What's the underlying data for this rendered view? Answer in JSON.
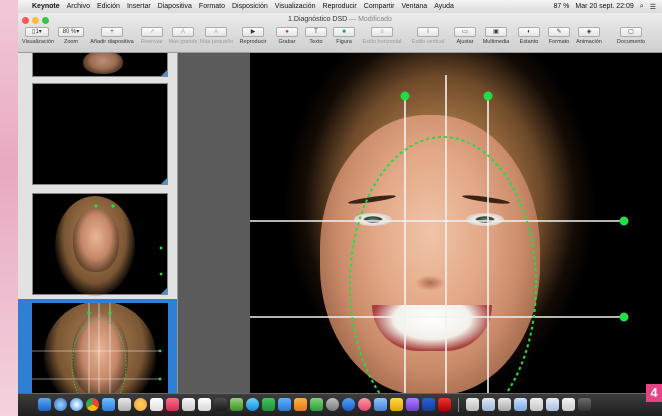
{
  "menubar": {
    "app_name": "Keynote",
    "items": [
      "Archivo",
      "Edición",
      "Insertar",
      "Diapositiva",
      "Formato",
      "Disposición",
      "Visualización",
      "Reproducir",
      "Compartir",
      "Ventana",
      "Ayuda"
    ],
    "battery": "87 %",
    "datetime": "Mar 20 sept. 22:09"
  },
  "window": {
    "title": "1.Diagnóstico DSD",
    "title_suffix": "— Modificado"
  },
  "toolbar": {
    "items": [
      {
        "label": "Visualización",
        "btn": "▯1▾"
      },
      {
        "label": "Zoom",
        "btn": "80 %▾"
      },
      {
        "label": "Añadir diapositiva",
        "btn": "+"
      },
      {
        "label": "Reenviar",
        "btn": "↗"
      },
      {
        "label": "Más grande",
        "btn": "A"
      },
      {
        "label": "Más pequeño",
        "btn": "A"
      },
      {
        "label": "Reproducir",
        "btn": "▶"
      },
      {
        "label": "Grabar",
        "btn": "●"
      },
      {
        "label": "Texto",
        "btn": "T"
      },
      {
        "label": "Figura",
        "btn": "■"
      },
      {
        "label": "Estilo horizontal",
        "btn": "≡"
      },
      {
        "label": "Estilo vertical",
        "btn": "⦀"
      },
      {
        "label": "Ajustar",
        "btn": "▭"
      },
      {
        "label": "Multimedia",
        "btn": "▣"
      },
      {
        "label": "Estanto",
        "btn": "◐"
      },
      {
        "label": "Formato",
        "btn": "✎"
      },
      {
        "label": "Animación",
        "btn": "◈"
      },
      {
        "label": "Documento",
        "btn": "▢"
      }
    ]
  },
  "page_number": "4",
  "colors": {
    "guide_green": "#22dd44",
    "guide_white": "#f2f2f2",
    "selection_blue": "#2f7fd6",
    "badge_pink": "#e64284"
  }
}
